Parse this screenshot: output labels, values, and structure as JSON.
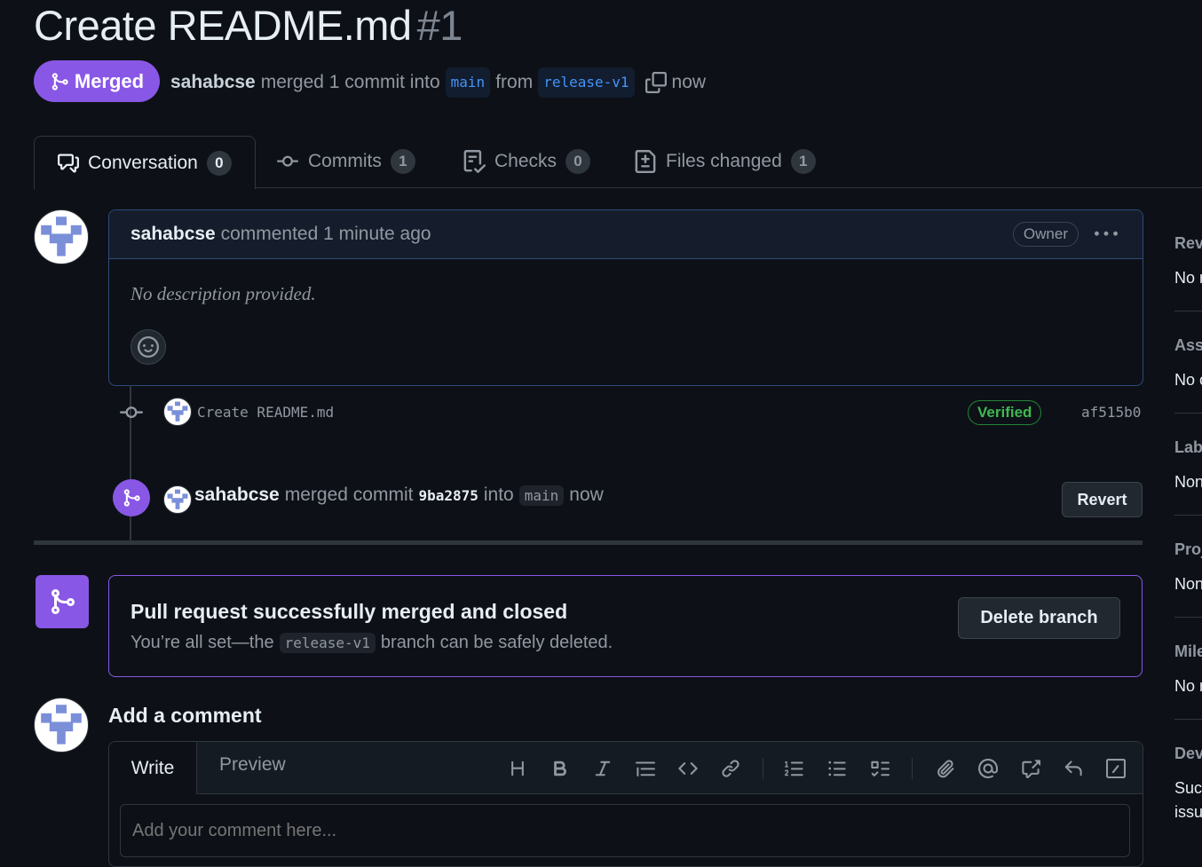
{
  "pr": {
    "title": "Create README.md",
    "number": "#1",
    "state": "Merged",
    "author": "sahabcse",
    "merge_text": "merged 1 commit into",
    "base_branch": "main",
    "from_text": "from",
    "head_branch": "release-v1",
    "time": "now"
  },
  "tabs": [
    {
      "label": "Conversation",
      "count": "0",
      "icon": "comment-discussion-icon"
    },
    {
      "label": "Commits",
      "count": "1",
      "icon": "git-commit-icon"
    },
    {
      "label": "Checks",
      "count": "0",
      "icon": "checklist-icon"
    },
    {
      "label": "Files changed",
      "count": "1",
      "icon": "file-diff-icon"
    }
  ],
  "comment": {
    "author": "sahabcse",
    "action": "commented 1 minute ago",
    "role_badge": "Owner",
    "body": "No description provided."
  },
  "commit": {
    "message": "Create README.md",
    "verified": "Verified",
    "sha": "af515b0"
  },
  "merge_event": {
    "author": "sahabcse",
    "text": "merged commit",
    "sha": "9ba2875",
    "into_text": "into",
    "branch": "main",
    "time": "now",
    "revert_label": "Revert"
  },
  "merged_box": {
    "title": "Pull request successfully merged and closed",
    "desc_before": "You’re all set—the",
    "branch": "release-v1",
    "desc_after": "branch can be safely deleted.",
    "delete_label": "Delete branch"
  },
  "add_comment": {
    "heading": "Add a comment",
    "write_tab": "Write",
    "preview_tab": "Preview",
    "placeholder": "Add your comment here..."
  },
  "sidebar": [
    {
      "heading": "Rev",
      "value": "No r"
    },
    {
      "heading": "Assi",
      "value": "No o"
    },
    {
      "heading": "Labe",
      "value": "Non"
    },
    {
      "heading": "Proj",
      "value": "Non"
    },
    {
      "heading": "Mile",
      "value": "No r"
    },
    {
      "heading": "Dev",
      "value": "Succ",
      "value2": "issu"
    }
  ],
  "colors": {
    "background": "#0d1117",
    "merged_purple": "#8957e5",
    "link_blue": "#4493f8",
    "verified_green": "#3fb950",
    "border": "#30363d"
  }
}
